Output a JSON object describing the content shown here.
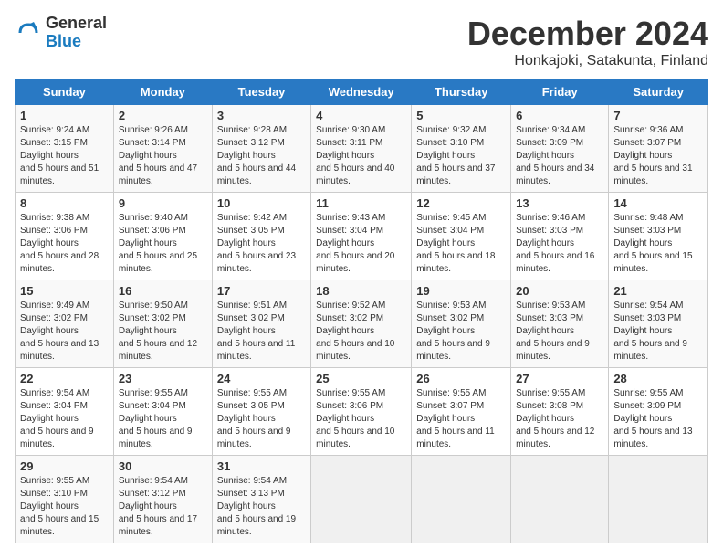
{
  "logo": {
    "general": "General",
    "blue": "Blue"
  },
  "title": "December 2024",
  "subtitle": "Honkajoki, Satakunta, Finland",
  "days_of_week": [
    "Sunday",
    "Monday",
    "Tuesday",
    "Wednesday",
    "Thursday",
    "Friday",
    "Saturday"
  ],
  "weeks": [
    [
      {
        "day": "1",
        "sunrise": "9:24 AM",
        "sunset": "3:15 PM",
        "daylight": "5 hours and 51 minutes."
      },
      {
        "day": "2",
        "sunrise": "9:26 AM",
        "sunset": "3:14 PM",
        "daylight": "5 hours and 47 minutes."
      },
      {
        "day": "3",
        "sunrise": "9:28 AM",
        "sunset": "3:12 PM",
        "daylight": "5 hours and 44 minutes."
      },
      {
        "day": "4",
        "sunrise": "9:30 AM",
        "sunset": "3:11 PM",
        "daylight": "5 hours and 40 minutes."
      },
      {
        "day": "5",
        "sunrise": "9:32 AM",
        "sunset": "3:10 PM",
        "daylight": "5 hours and 37 minutes."
      },
      {
        "day": "6",
        "sunrise": "9:34 AM",
        "sunset": "3:09 PM",
        "daylight": "5 hours and 34 minutes."
      },
      {
        "day": "7",
        "sunrise": "9:36 AM",
        "sunset": "3:07 PM",
        "daylight": "5 hours and 31 minutes."
      }
    ],
    [
      {
        "day": "8",
        "sunrise": "9:38 AM",
        "sunset": "3:06 PM",
        "daylight": "5 hours and 28 minutes."
      },
      {
        "day": "9",
        "sunrise": "9:40 AM",
        "sunset": "3:06 PM",
        "daylight": "5 hours and 25 minutes."
      },
      {
        "day": "10",
        "sunrise": "9:42 AM",
        "sunset": "3:05 PM",
        "daylight": "5 hours and 23 minutes."
      },
      {
        "day": "11",
        "sunrise": "9:43 AM",
        "sunset": "3:04 PM",
        "daylight": "5 hours and 20 minutes."
      },
      {
        "day": "12",
        "sunrise": "9:45 AM",
        "sunset": "3:04 PM",
        "daylight": "5 hours and 18 minutes."
      },
      {
        "day": "13",
        "sunrise": "9:46 AM",
        "sunset": "3:03 PM",
        "daylight": "5 hours and 16 minutes."
      },
      {
        "day": "14",
        "sunrise": "9:48 AM",
        "sunset": "3:03 PM",
        "daylight": "5 hours and 15 minutes."
      }
    ],
    [
      {
        "day": "15",
        "sunrise": "9:49 AM",
        "sunset": "3:02 PM",
        "daylight": "5 hours and 13 minutes."
      },
      {
        "day": "16",
        "sunrise": "9:50 AM",
        "sunset": "3:02 PM",
        "daylight": "5 hours and 12 minutes."
      },
      {
        "day": "17",
        "sunrise": "9:51 AM",
        "sunset": "3:02 PM",
        "daylight": "5 hours and 11 minutes."
      },
      {
        "day": "18",
        "sunrise": "9:52 AM",
        "sunset": "3:02 PM",
        "daylight": "5 hours and 10 minutes."
      },
      {
        "day": "19",
        "sunrise": "9:53 AM",
        "sunset": "3:02 PM",
        "daylight": "5 hours and 9 minutes."
      },
      {
        "day": "20",
        "sunrise": "9:53 AM",
        "sunset": "3:03 PM",
        "daylight": "5 hours and 9 minutes."
      },
      {
        "day": "21",
        "sunrise": "9:54 AM",
        "sunset": "3:03 PM",
        "daylight": "5 hours and 9 minutes."
      }
    ],
    [
      {
        "day": "22",
        "sunrise": "9:54 AM",
        "sunset": "3:04 PM",
        "daylight": "5 hours and 9 minutes."
      },
      {
        "day": "23",
        "sunrise": "9:55 AM",
        "sunset": "3:04 PM",
        "daylight": "5 hours and 9 minutes."
      },
      {
        "day": "24",
        "sunrise": "9:55 AM",
        "sunset": "3:05 PM",
        "daylight": "5 hours and 9 minutes."
      },
      {
        "day": "25",
        "sunrise": "9:55 AM",
        "sunset": "3:06 PM",
        "daylight": "5 hours and 10 minutes."
      },
      {
        "day": "26",
        "sunrise": "9:55 AM",
        "sunset": "3:07 PM",
        "daylight": "5 hours and 11 minutes."
      },
      {
        "day": "27",
        "sunrise": "9:55 AM",
        "sunset": "3:08 PM",
        "daylight": "5 hours and 12 minutes."
      },
      {
        "day": "28",
        "sunrise": "9:55 AM",
        "sunset": "3:09 PM",
        "daylight": "5 hours and 13 minutes."
      }
    ],
    [
      {
        "day": "29",
        "sunrise": "9:55 AM",
        "sunset": "3:10 PM",
        "daylight": "5 hours and 15 minutes."
      },
      {
        "day": "30",
        "sunrise": "9:54 AM",
        "sunset": "3:12 PM",
        "daylight": "5 hours and 17 minutes."
      },
      {
        "day": "31",
        "sunrise": "9:54 AM",
        "sunset": "3:13 PM",
        "daylight": "5 hours and 19 minutes."
      },
      null,
      null,
      null,
      null
    ]
  ]
}
